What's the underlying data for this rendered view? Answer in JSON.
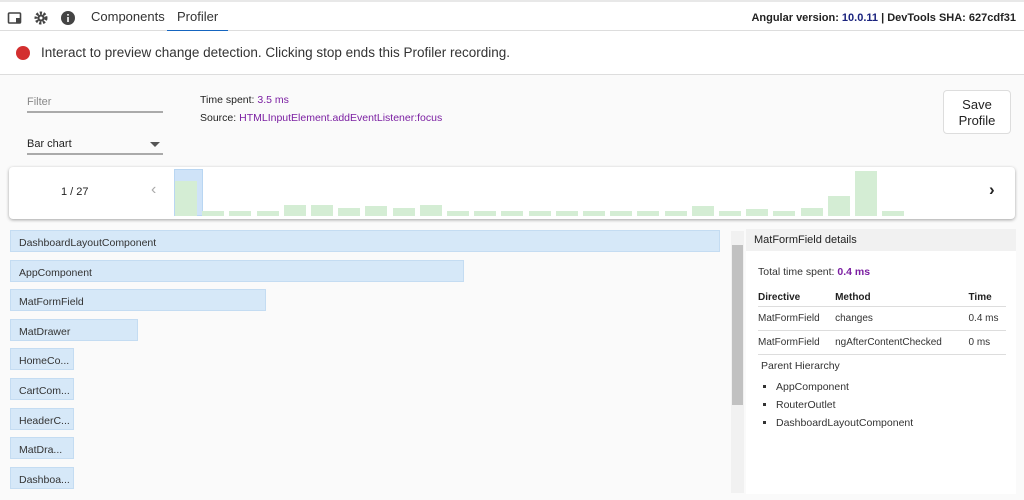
{
  "tabs": [
    {
      "label": "Components"
    },
    {
      "label": "Profiler"
    }
  ],
  "version": {
    "label": "Angular version: ",
    "value": "10.0.11",
    "sha": " | DevTools SHA: 627cdf31"
  },
  "banner": {
    "text": "Interact to preview change detection. Clicking stop ends this Profiler recording."
  },
  "filter": {
    "placeholder": "Filter"
  },
  "view_select": {
    "value": "Bar chart"
  },
  "summary": {
    "time_label": "Time spent: ",
    "time_value": "3.5 ms",
    "source_label": "Source: ",
    "source_value": "HTMLInputElement.addEventListener:focus"
  },
  "save_button": {
    "line1": "Save",
    "line2": "Profile"
  },
  "timeline": {
    "page": "1 / 27",
    "selected_index": 0,
    "accent": "#d4edd4",
    "frames_ms": [
      3.5,
      0.5,
      0.5,
      0.5,
      1.1,
      1.1,
      0.8,
      1.0,
      0.8,
      1.1,
      0.5,
      0.5,
      0.5,
      0.5,
      0.5,
      0.5,
      0.5,
      0.5,
      0.5,
      1.0,
      0.5,
      0.7,
      0.5,
      0.8,
      2.0,
      4.5,
      0.5
    ]
  },
  "flame": [
    {
      "label": "DashboardLayoutComponent",
      "share": 1.0
    },
    {
      "label": "AppComponent",
      "share": 0.64
    },
    {
      "label": "MatFormField",
      "share": 0.36
    },
    {
      "label": "MatDrawer",
      "share": 0.18
    },
    {
      "label": "HomeCo...",
      "share": 0.09
    },
    {
      "label": "CartCom...",
      "share": 0.09
    },
    {
      "label": "HeaderC...",
      "share": 0.09
    },
    {
      "label": "MatDra...",
      "share": 0.09
    },
    {
      "label": "Dashboa...",
      "share": 0.09
    }
  ],
  "details": {
    "title": "MatFormField details",
    "total_label": "Total time spent: ",
    "total_value": "0.4 ms",
    "headers": [
      "Directive",
      "Method",
      "Time"
    ],
    "rows": [
      [
        "MatFormField",
        "changes",
        "0.4 ms"
      ],
      [
        "MatFormField",
        "ngAfterContentChecked",
        "0 ms"
      ]
    ],
    "hierarchy_title": "Parent Hierarchy",
    "hierarchy": [
      "AppComponent",
      "RouterOutlet",
      "DashboardLayoutComponent"
    ]
  }
}
